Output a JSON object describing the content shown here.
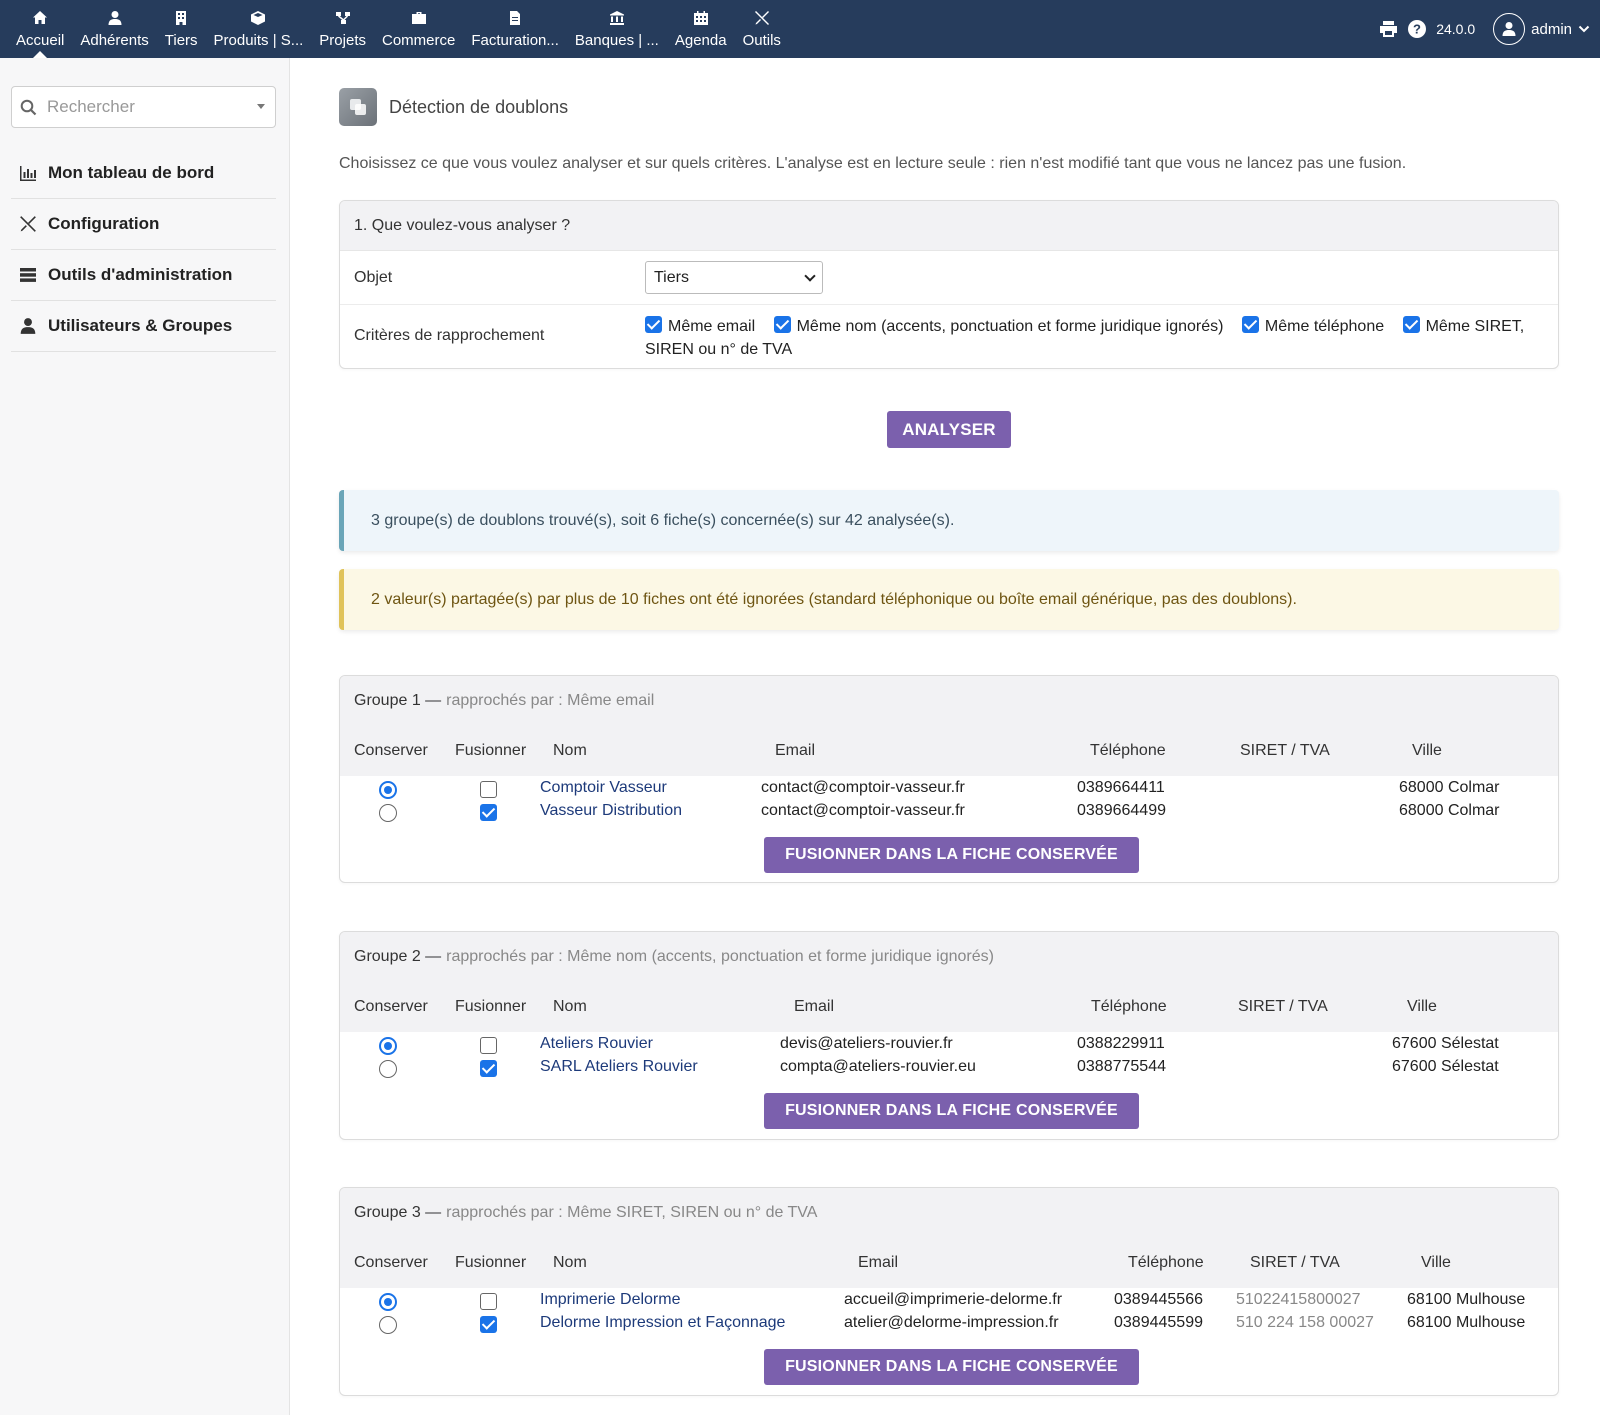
{
  "topnav": {
    "items": [
      {
        "label": "Accueil",
        "icon": "home-icon"
      },
      {
        "label": "Adhérents",
        "icon": "user-icon"
      },
      {
        "label": "Tiers",
        "icon": "building-icon"
      },
      {
        "label": "Produits | S...",
        "icon": "cube-icon"
      },
      {
        "label": "Projets",
        "icon": "project-icon"
      },
      {
        "label": "Commerce",
        "icon": "briefcase-icon"
      },
      {
        "label": "Facturation...",
        "icon": "invoice-icon"
      },
      {
        "label": "Banques | ...",
        "icon": "bank-icon"
      },
      {
        "label": "Agenda",
        "icon": "calendar-icon"
      },
      {
        "label": "Outils",
        "icon": "tools-icon"
      }
    ],
    "version": "24.0.0",
    "user": "admin"
  },
  "sidebar": {
    "search_placeholder": "Rechercher",
    "items": [
      {
        "label": "Mon tableau de bord",
        "icon": "chart-icon"
      },
      {
        "label": "Configuration",
        "icon": "tools-icon"
      },
      {
        "label": "Outils d'administration",
        "icon": "server-icon"
      },
      {
        "label": "Utilisateurs & Groupes",
        "icon": "user-icon"
      }
    ]
  },
  "page": {
    "title": "Détection de doublons",
    "intro": "Choisissez ce que vous voulez analyser et sur quels critères. L'analyse est en lecture seule : rien n'est modifié tant que vous ne lancez pas une fusion."
  },
  "form": {
    "heading": "1. Que voulez-vous analyser ?",
    "object_label": "Objet",
    "object_value": "Tiers",
    "criteria_label": "Critères de rapprochement",
    "criteria": [
      {
        "label": "Même email",
        "checked": true
      },
      {
        "label": "Même nom (accents, ponctuation et forme juridique ignorés)",
        "checked": true
      },
      {
        "label": "Même téléphone",
        "checked": true
      },
      {
        "label": "Même SIRET, SIREN ou n° de TVA",
        "checked": true
      }
    ],
    "analyze_label": "ANALYSER"
  },
  "alerts": {
    "info": "3 groupe(s) de doublons trouvé(s), soit 6 fiche(s) concernée(s) sur 42 analysée(s).",
    "warning": "2 valeur(s) partagée(s) par plus de 10 fiches ont été ignorées (standard téléphonique ou boîte email générique, pas des doublons)."
  },
  "columns": {
    "keep": "Conserver",
    "merge": "Fusionner",
    "name": "Nom",
    "email": "Email",
    "phone": "Téléphone",
    "siret": "SIRET / TVA",
    "city": "Ville"
  },
  "merge_label": "FUSIONNER DANS LA FICHE CONSERVÉE",
  "groups": [
    {
      "title": "Groupe 1 —",
      "subtitle": "rapprochés par : Même email",
      "rows": [
        {
          "keep": true,
          "merge": false,
          "name": "Comptoir Vasseur",
          "email": "contact@comptoir-vasseur.fr",
          "phone": "0389664411",
          "siret": "",
          "city": "68000 Colmar"
        },
        {
          "keep": false,
          "merge": true,
          "name": "Vasseur Distribution",
          "email": "contact@comptoir-vasseur.fr",
          "phone": "0389664499",
          "siret": "",
          "city": "68000 Colmar"
        }
      ]
    },
    {
      "title": "Groupe 2 —",
      "subtitle": "rapprochés par : Même nom (accents, ponctuation et forme juridique ignorés)",
      "rows": [
        {
          "keep": true,
          "merge": false,
          "name": "Ateliers Rouvier",
          "email": "devis@ateliers-rouvier.fr",
          "phone": "0388229911",
          "siret": "",
          "city": "67600 Sélestat"
        },
        {
          "keep": false,
          "merge": true,
          "name": "SARL Ateliers Rouvier",
          "email": "compta@ateliers-rouvier.eu",
          "phone": "0388775544",
          "siret": "",
          "city": "67600 Sélestat"
        }
      ]
    },
    {
      "title": "Groupe 3 —",
      "subtitle": "rapprochés par : Même SIRET, SIREN ou n° de TVA",
      "rows": [
        {
          "keep": true,
          "merge": false,
          "name": "Imprimerie Delorme",
          "email": "accueil@imprimerie-delorme.fr",
          "phone": "0389445566",
          "siret": "51022415800027",
          "city": "68100 Mulhouse"
        },
        {
          "keep": false,
          "merge": true,
          "name": "Delorme Impression et Façonnage",
          "email": "atelier@delorme-impression.fr",
          "phone": "0389445599",
          "siret": "510 224 158 00027",
          "city": "68100 Mulhouse"
        }
      ]
    }
  ],
  "colors": {
    "topbar": "#263c5c",
    "button": "#7b60ad",
    "link": "#1d3a7a",
    "check": "#1a73e8"
  }
}
